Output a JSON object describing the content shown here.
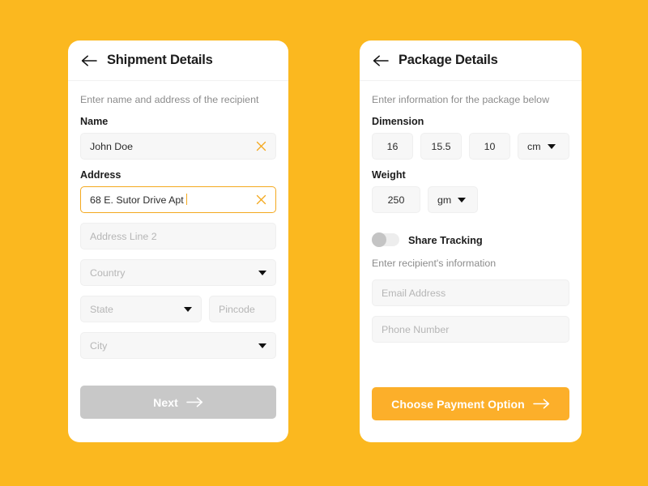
{
  "background_color": "#FBB81F",
  "accent_color": "#F4A91F",
  "shipment_card": {
    "back_icon": "arrow-left-icon",
    "title": "Shipment Details",
    "helper_text": "Enter name and address of the recipient",
    "name_label": "Name",
    "name_value": "John Doe",
    "name_clear_icon": "close-x-icon",
    "address_label": "Address",
    "address_value": "68 E. Sutor Drive Apt",
    "address_clear_icon": "close-x-icon",
    "address_line2_placeholder": "Address Line 2",
    "country_placeholder": "Country",
    "state_placeholder": "State",
    "pincode_placeholder": "Pincode",
    "city_placeholder": "City",
    "next_label": "Next",
    "next_arrow_icon": "arrow-right-icon"
  },
  "package_card": {
    "back_icon": "arrow-left-icon",
    "title": "Package Details",
    "helper_text": "Enter information for the package below",
    "dimension_label": "Dimension",
    "dimension_length": "16",
    "dimension_width": "15.5",
    "dimension_height": "10",
    "dimension_unit": "cm",
    "weight_label": "Weight",
    "weight_value": "250",
    "weight_unit": "gm",
    "share_tracking_label": "Share Tracking",
    "share_tracking_on": false,
    "recipient_helper_text": "Enter recipient's information",
    "email_placeholder": "Email Address",
    "phone_placeholder": "Phone Number",
    "payment_label": "Choose Payment Option",
    "payment_arrow_icon": "arrow-right-icon"
  }
}
